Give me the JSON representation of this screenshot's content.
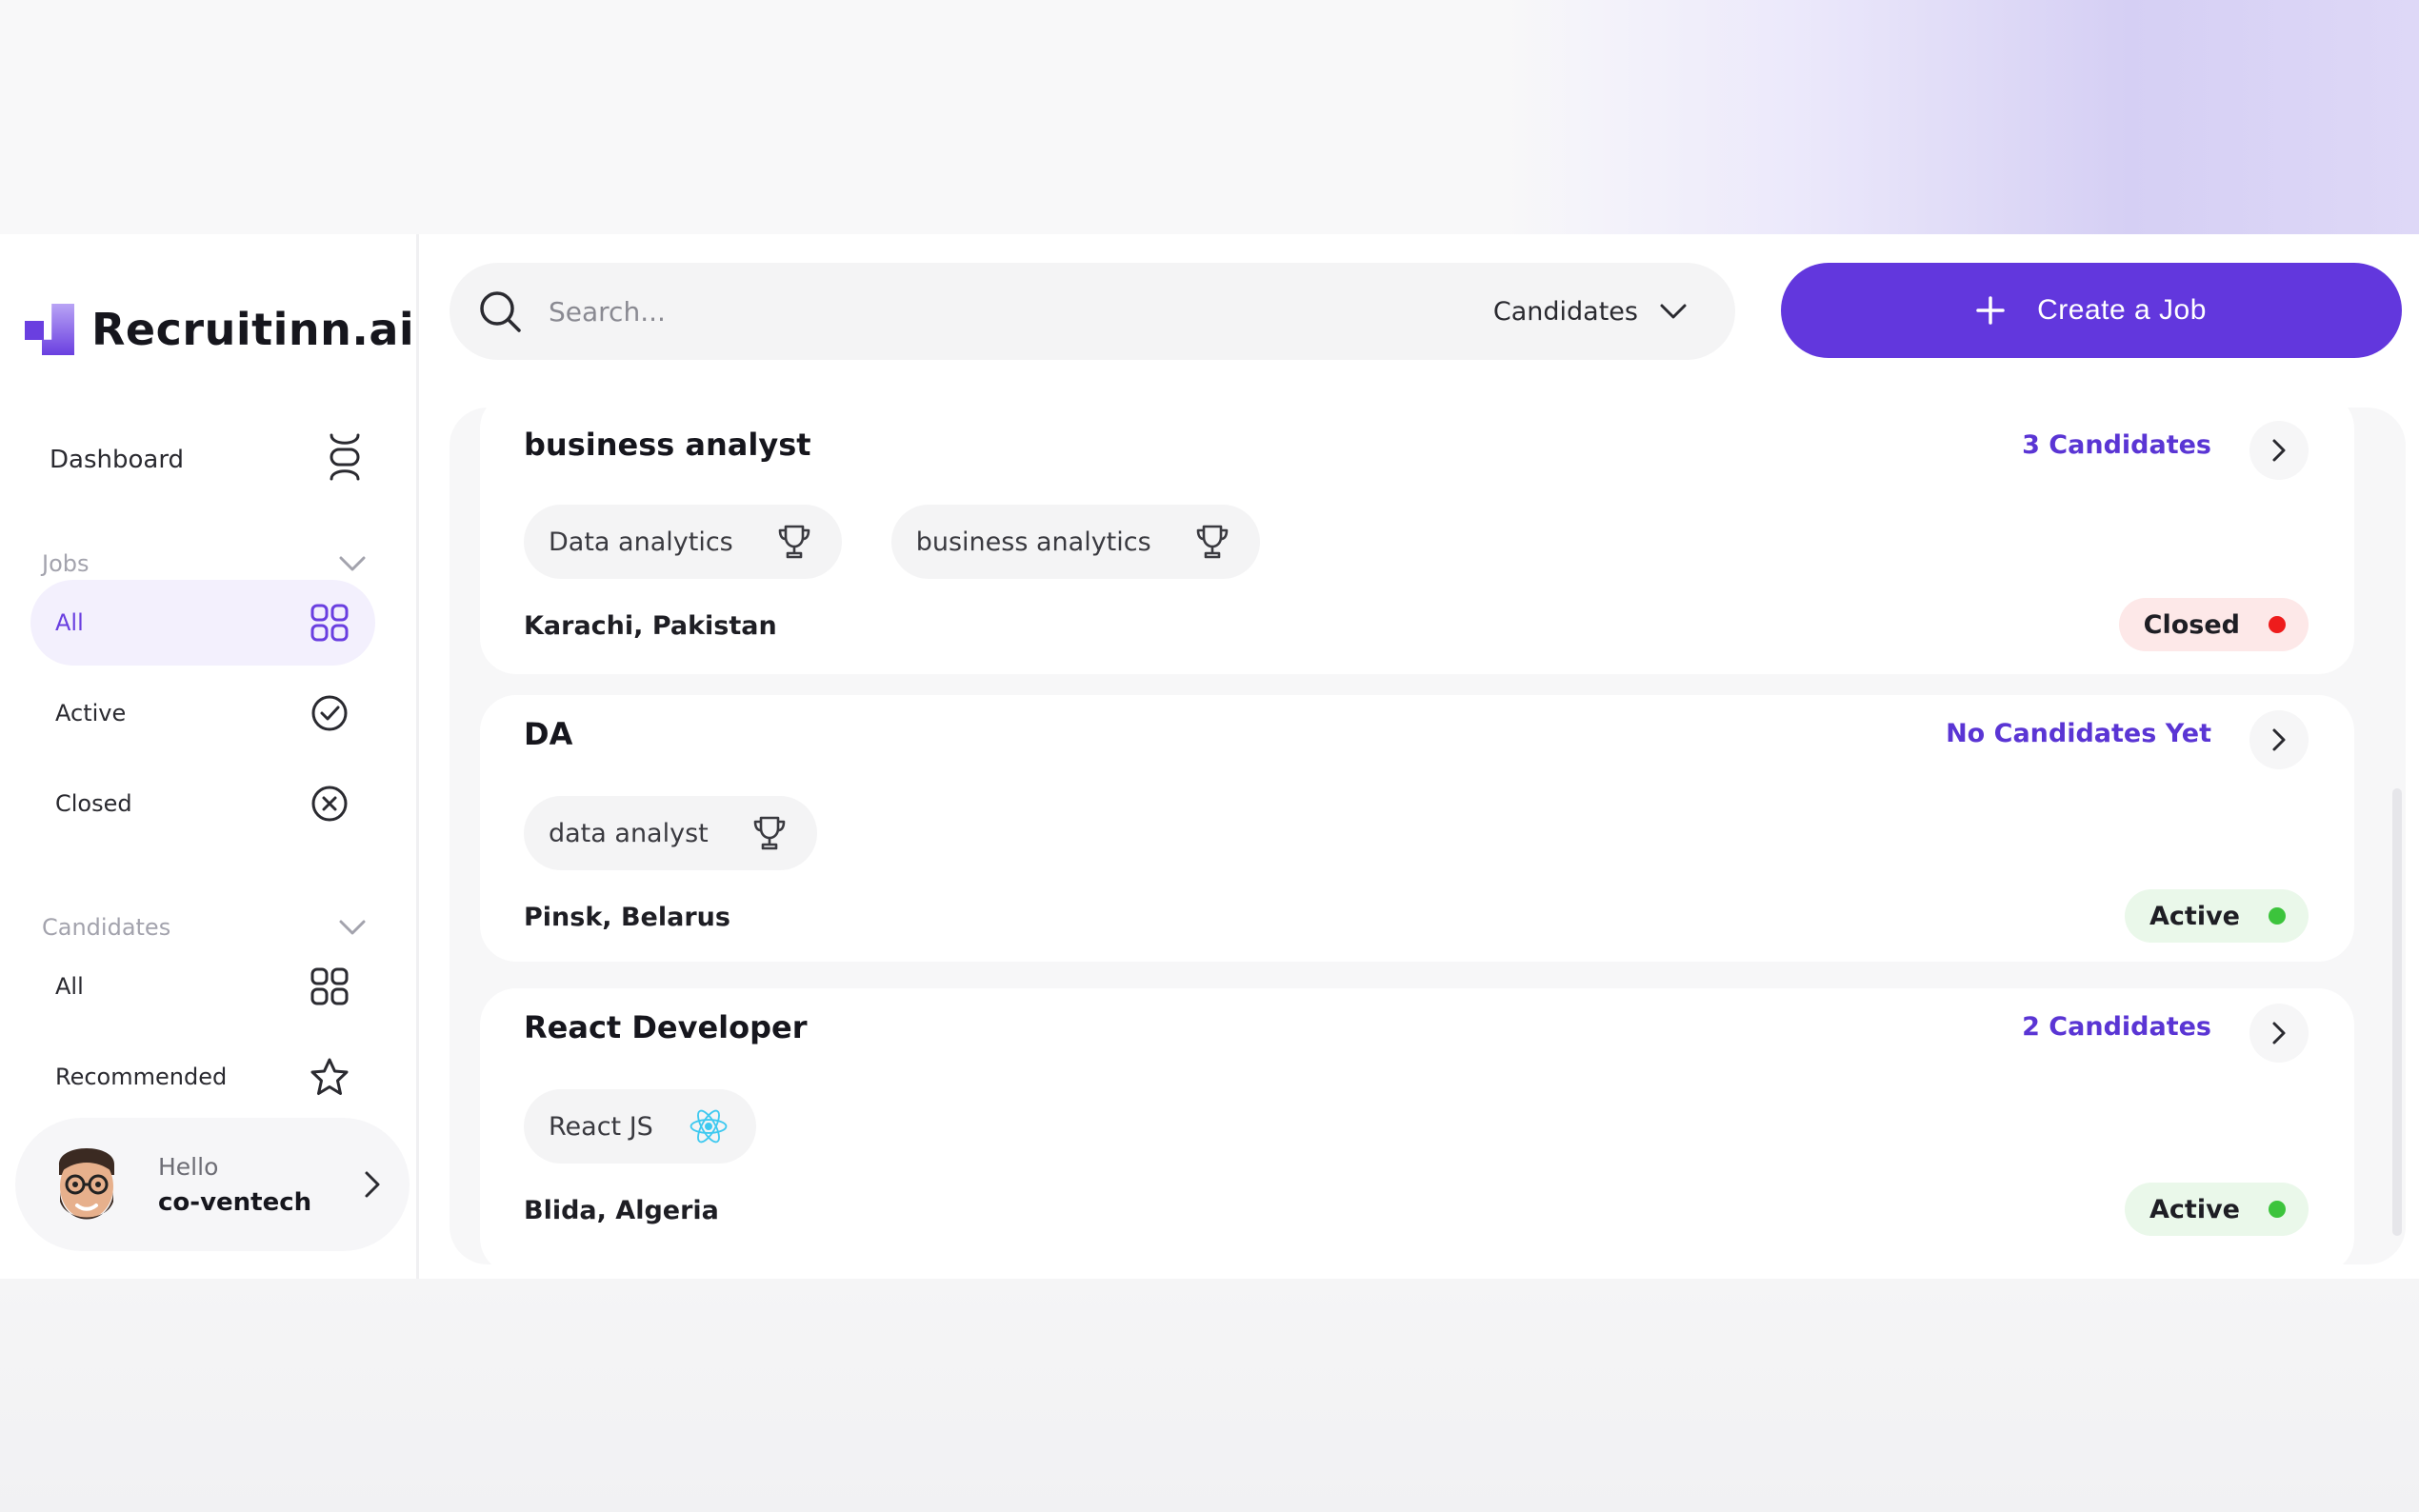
{
  "brand": {
    "name": "Recruitinn.ai",
    "accent": "#6237dd"
  },
  "sidebar": {
    "dashboard_label": "Dashboard",
    "jobs_section": "Jobs",
    "jobs_items": [
      {
        "label": "All",
        "icon": "grid-icon",
        "active": true
      },
      {
        "label": "Active",
        "icon": "check-circle-icon"
      },
      {
        "label": "Closed",
        "icon": "x-circle-icon"
      }
    ],
    "candidates_section": "Candidates",
    "candidates_items": [
      {
        "label": "All",
        "icon": "grid-icon"
      },
      {
        "label": "Recommended",
        "icon": "star-icon"
      }
    ],
    "user": {
      "greeting": "Hello",
      "name": "co-ventech"
    }
  },
  "search": {
    "placeholder": "Search...",
    "filter": "Candidates"
  },
  "create_button": {
    "label": "Create a Job"
  },
  "jobs": [
    {
      "title": "business analyst",
      "candidates": "3 Candidates",
      "skills": [
        {
          "name": "Data analytics",
          "icon": "trophy-icon"
        },
        {
          "name": "business analytics",
          "icon": "trophy-icon"
        }
      ],
      "location": "Karachi, Pakistan",
      "status": "Closed",
      "status_color": "#ee1c1c"
    },
    {
      "title": "DA",
      "candidates": "No Candidates Yet",
      "skills": [
        {
          "name": "data analyst",
          "icon": "trophy-icon"
        }
      ],
      "location": "Pinsk, Belarus",
      "status": "Active",
      "status_color": "#3cc43c"
    },
    {
      "title": "React Developer",
      "candidates": "2 Candidates",
      "skills": [
        {
          "name": "React JS",
          "icon": "react-icon"
        }
      ],
      "location": "Blida, Algeria",
      "status": "Active",
      "status_color": "#3cc43c"
    }
  ]
}
